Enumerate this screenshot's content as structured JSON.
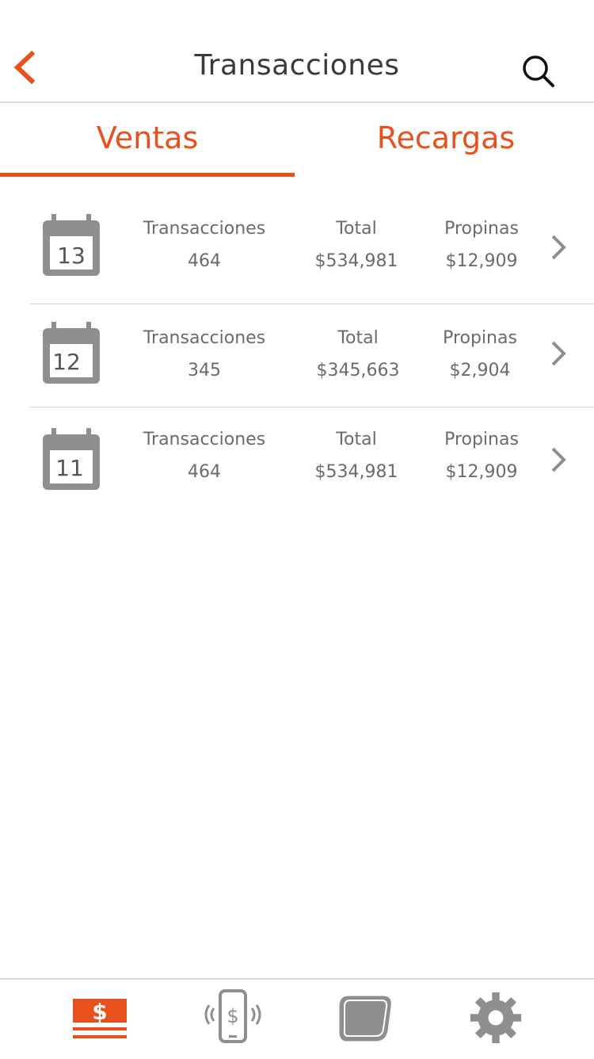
{
  "header": {
    "title": "Transacciones"
  },
  "tabs": [
    {
      "label": "Ventas"
    },
    {
      "label": "Recargas"
    }
  ],
  "rows": [
    {
      "day": "13",
      "transacciones_label": "Transacciones",
      "transacciones": "464",
      "total_label": "Total",
      "total": "$534,981",
      "propinas_label": "Propinas",
      "propinas": "$12,909"
    },
    {
      "day": "12",
      "transacciones_label": "Transacciones",
      "transacciones": "345",
      "total_label": "Total",
      "total": "$345,663",
      "propinas_label": "Propinas",
      "propinas": "$2,904"
    },
    {
      "day": "11",
      "transacciones_label": "Transacciones",
      "transacciones": "464",
      "total_label": "Total",
      "total": "$534,981",
      "propinas_label": "Propinas",
      "propinas": "$12,909"
    }
  ],
  "tabbar": {
    "items": [
      {
        "icon": "sales-cash-icon",
        "active": true
      },
      {
        "icon": "phone-payment-icon",
        "active": false
      },
      {
        "icon": "card-icon",
        "active": false
      },
      {
        "icon": "gear-icon",
        "active": false
      }
    ]
  },
  "colors": {
    "accent": "#e8501c",
    "icon_gray": "#8f8f8f",
    "text_gray": "#6b6b6b"
  }
}
